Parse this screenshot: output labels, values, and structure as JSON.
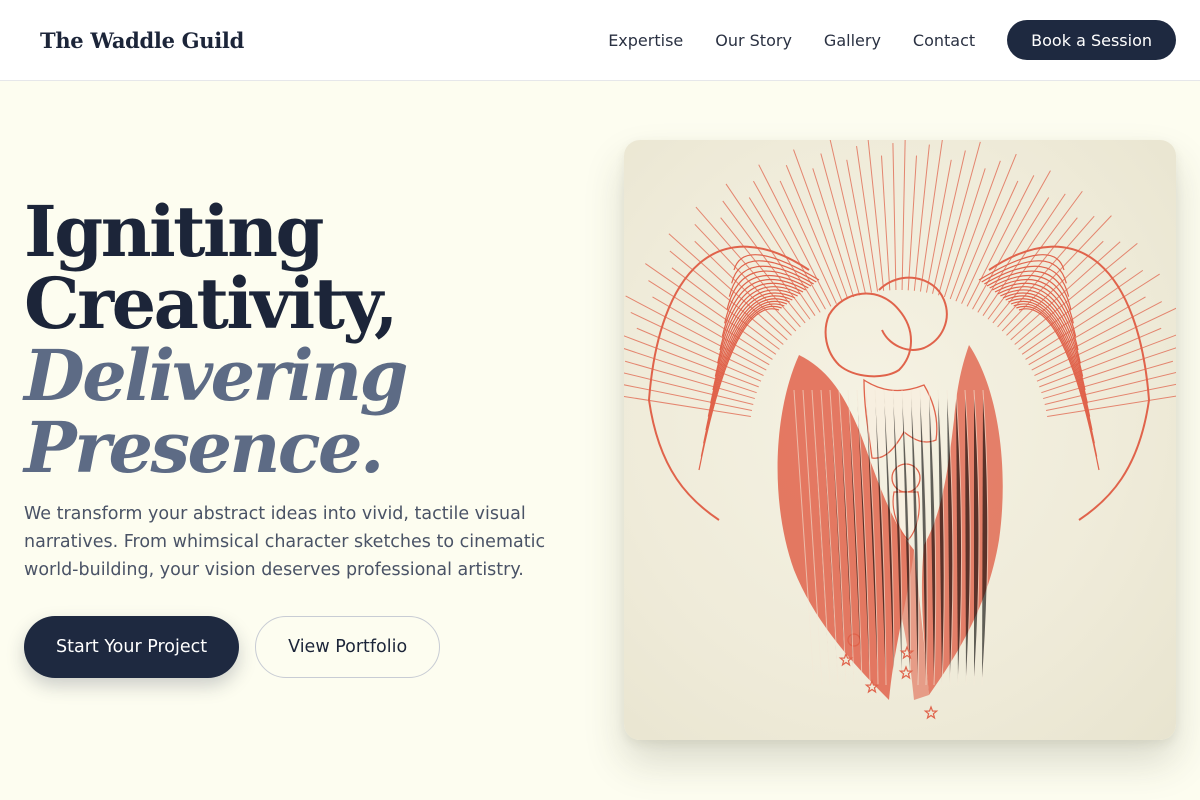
{
  "header": {
    "brand": "The Waddle Guild",
    "nav": [
      "Expertise",
      "Our Story",
      "Gallery",
      "Contact"
    ],
    "cta": "Book a Session"
  },
  "hero": {
    "headline": {
      "line1": "Igniting",
      "line2": "Creativity,",
      "line3": "Delivering",
      "line4": "Presence."
    },
    "lede": "We transform your abstract ideas into vivid, tactile visual narratives. From whimsical character sketches to cinematic world-building, your vision deserves professional artistry.",
    "primary_cta": "Start Your Project",
    "secondary_cta": "View Portfolio"
  },
  "colors": {
    "background": "#fdfdf0",
    "navy": "#1e2940",
    "slate_accent": "#5d6b85",
    "illustration_red": "#e0634b"
  },
  "illustration": {
    "name": "angel-engraving-illustration"
  }
}
